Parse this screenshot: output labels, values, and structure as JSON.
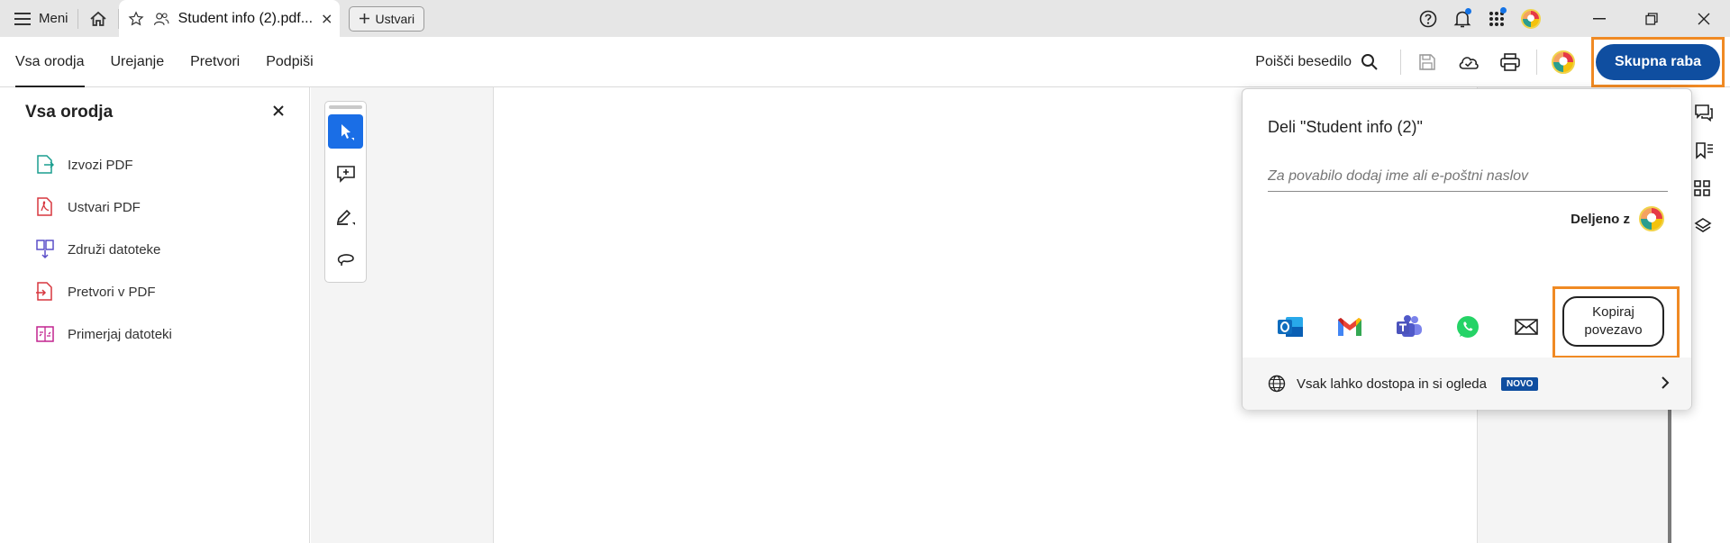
{
  "titlebar": {
    "menu_label": "Meni",
    "tab_title": "Student info (2).pdf...",
    "new_tab_label": "Ustvari"
  },
  "toolbar": {
    "tabs": [
      {
        "label": "Vsa orodja",
        "active": true
      },
      {
        "label": "Urejanje",
        "active": false
      },
      {
        "label": "Pretvori",
        "active": false
      },
      {
        "label": "Podpiši",
        "active": false
      }
    ],
    "find_label": "Poišči besedilo",
    "share_label": "Skupna raba"
  },
  "left_panel": {
    "title": "Vsa orodja",
    "items": [
      {
        "label": "Izvozi PDF",
        "icon": "export-pdf-icon",
        "color": "#1a9e8f"
      },
      {
        "label": "Ustvari PDF",
        "icon": "create-pdf-icon",
        "color": "#d7373f"
      },
      {
        "label": "Združi datoteke",
        "icon": "combine-files-icon",
        "color": "#5b4fc9"
      },
      {
        "label": "Pretvori v PDF",
        "icon": "convert-to-pdf-icon",
        "color": "#d7373f"
      },
      {
        "label": "Primerjaj datoteki",
        "icon": "compare-files-icon",
        "color": "#c2248f"
      }
    ]
  },
  "share_popover": {
    "title": "Deli \"Student info (2)\"",
    "input_placeholder": "Za povabilo dodaj ime ali e-poštni naslov",
    "shared_with_label": "Deljeno z",
    "copy_link_line1": "Kopiraj",
    "copy_link_line2": "povezavo",
    "footer_text": "Vsak lahko dostopa in si ogleda",
    "footer_badge": "NOVO",
    "apps": [
      "outlook-icon",
      "gmail-icon",
      "teams-icon",
      "whatsapp-icon",
      "mail-icon"
    ]
  },
  "colors": {
    "accent_blue": "#0f4ea0",
    "highlight_orange": "#f08a24",
    "tool_active": "#1a6ee6"
  }
}
